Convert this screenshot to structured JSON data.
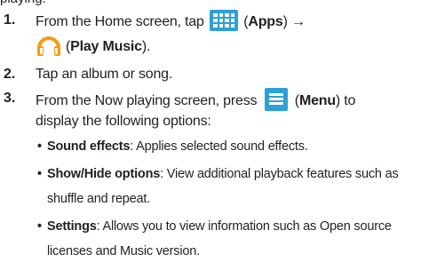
{
  "clipped_heading": "playing.",
  "steps": [
    {
      "number": "1.",
      "text_a": "From the Home screen, tap",
      "apps_label": "Apps",
      "arrow": "→",
      "music_label": "Play Music"
    },
    {
      "number": "2.",
      "text": "Tap an album or song."
    },
    {
      "number": "3.",
      "text_a": "From the Now playing screen, press",
      "menu_label": "Menu",
      "text_b": "to",
      "text_c": "display the following options:"
    }
  ],
  "options": [
    {
      "term": "Sound effects",
      "desc": ": Applies selected sound effects."
    },
    {
      "term": "Show/Hide options",
      "desc_line1": ": View additional playback features such as",
      "desc_line2": "shuffle and repeat."
    },
    {
      "term": "Settings",
      "desc_line1": ": Allows you to view information such as Open source",
      "desc_line2": "licenses and Music version."
    }
  ],
  "icons": {
    "apps": "apps-grid-icon",
    "music": "play-music-headphones-icon",
    "menu": "menu-icon"
  },
  "colors": {
    "icon_blue": "#2e9fd8",
    "headphone_orange": "#f39c12",
    "text": "#231f20"
  }
}
